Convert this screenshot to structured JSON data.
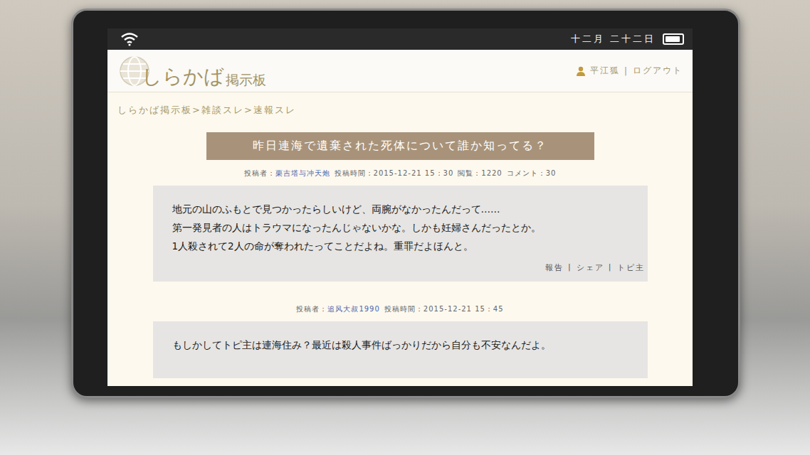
{
  "status_bar": {
    "date": "十二月 二十二日",
    "battery": {
      "level": 0.9
    }
  },
  "site": {
    "logo": "しらかば",
    "logo_suffix": "掲示板"
  },
  "user": {
    "name": "平江狐",
    "separator": "|",
    "action": "ログアウト"
  },
  "breadcrumb": {
    "items": [
      "しらかば掲示板",
      "雑談スレ",
      "速報スレ"
    ],
    "separator": ">"
  },
  "thread": {
    "title": "昨日連海で遺棄された死体について誰か知ってる？"
  },
  "posts": [
    {
      "meta": [
        {
          "label": "投稿者：",
          "value": "栗吉塔与冲天炮",
          "link": true
        },
        {
          "label": "投稿時間：",
          "value": "2015-12-21 15：30",
          "link": false
        },
        {
          "label": "閲覧：",
          "value": "1220",
          "link": false
        },
        {
          "label": "コメント：",
          "value": "30",
          "link": false
        }
      ],
      "lines": [
        "地元の山のふもとで見つかったらしいけど、両腕がなかったんだって……",
        "第一発見者の人はトラウマになったんじゃないかな。しかも妊婦さんだったとか。",
        "1人殺されて2人の命が奪われたってことだよね。重罪だよほんと。"
      ],
      "actions": [
        "報告",
        "シェア",
        "トピ主"
      ],
      "action_separator": "|"
    },
    {
      "meta": [
        {
          "label": "投稿者：",
          "value": "追风大叔1990",
          "link": true
        },
        {
          "label": "投稿時間：",
          "value": "2015-12-21 15：45",
          "link": false
        }
      ],
      "lines": [
        "もしかしてトピ主は連海住み？最近は殺人事件ばっかりだから自分も不安なんだよ。"
      ],
      "actions": [],
      "action_separator": "|"
    }
  ]
}
